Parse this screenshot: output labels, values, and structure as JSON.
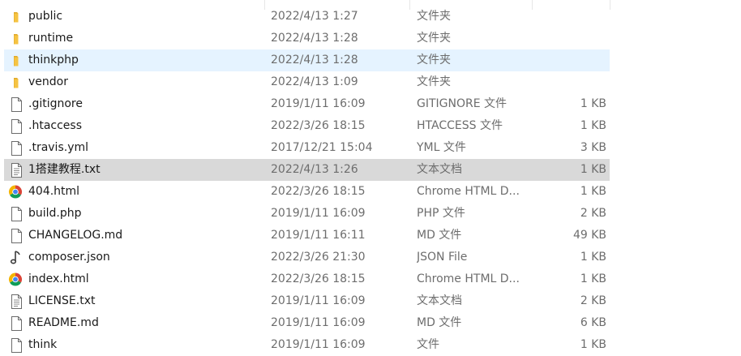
{
  "files": [
    {
      "name": "public",
      "date": "2022/4/13 1:27",
      "type": "文件夹",
      "size": "",
      "icon": "folder-icon"
    },
    {
      "name": "runtime",
      "date": "2022/4/13 1:28",
      "type": "文件夹",
      "size": "",
      "icon": "folder-icon"
    },
    {
      "name": "thinkphp",
      "date": "2022/4/13 1:28",
      "type": "文件夹",
      "size": "",
      "icon": "folder-icon",
      "state": "hover"
    },
    {
      "name": "vendor",
      "date": "2022/4/13 1:09",
      "type": "文件夹",
      "size": "",
      "icon": "folder-icon"
    },
    {
      "name": ".gitignore",
      "date": "2019/1/11 16:09",
      "type": "GITIGNORE 文件",
      "size": "1 KB",
      "icon": "file-icon"
    },
    {
      "name": ".htaccess",
      "date": "2022/3/26 18:15",
      "type": "HTACCESS 文件",
      "size": "1 KB",
      "icon": "file-icon"
    },
    {
      "name": ".travis.yml",
      "date": "2017/12/21 15:04",
      "type": "YML 文件",
      "size": "3 KB",
      "icon": "file-icon"
    },
    {
      "name": "1搭建教程.txt",
      "date": "2022/4/13 1:26",
      "type": "文本文档",
      "size": "1 KB",
      "icon": "text-file-icon",
      "state": "selected"
    },
    {
      "name": "404.html",
      "date": "2022/3/26 18:15",
      "type": "Chrome HTML D...",
      "size": "1 KB",
      "icon": "chrome-icon"
    },
    {
      "name": "build.php",
      "date": "2019/1/11 16:09",
      "type": "PHP 文件",
      "size": "2 KB",
      "icon": "file-icon"
    },
    {
      "name": "CHANGELOG.md",
      "date": "2019/1/11 16:11",
      "type": "MD 文件",
      "size": "49 KB",
      "icon": "file-icon"
    },
    {
      "name": "composer.json",
      "date": "2022/3/26 21:30",
      "type": "JSON File",
      "size": "1 KB",
      "icon": "json-file-icon"
    },
    {
      "name": "index.html",
      "date": "2022/3/26 18:15",
      "type": "Chrome HTML D...",
      "size": "1 KB",
      "icon": "chrome-icon"
    },
    {
      "name": "LICENSE.txt",
      "date": "2019/1/11 16:09",
      "type": "文本文档",
      "size": "2 KB",
      "icon": "text-file-icon"
    },
    {
      "name": "README.md",
      "date": "2019/1/11 16:09",
      "type": "MD 文件",
      "size": "6 KB",
      "icon": "file-icon"
    },
    {
      "name": "think",
      "date": "2019/1/11 16:09",
      "type": "文件",
      "size": "1 KB",
      "icon": "file-icon"
    }
  ],
  "colors": {
    "hover_row": "#e5f3ff",
    "selected_row": "#d9d9d9",
    "folder": "#f5c342",
    "secondary_text": "#6d6d6d"
  }
}
